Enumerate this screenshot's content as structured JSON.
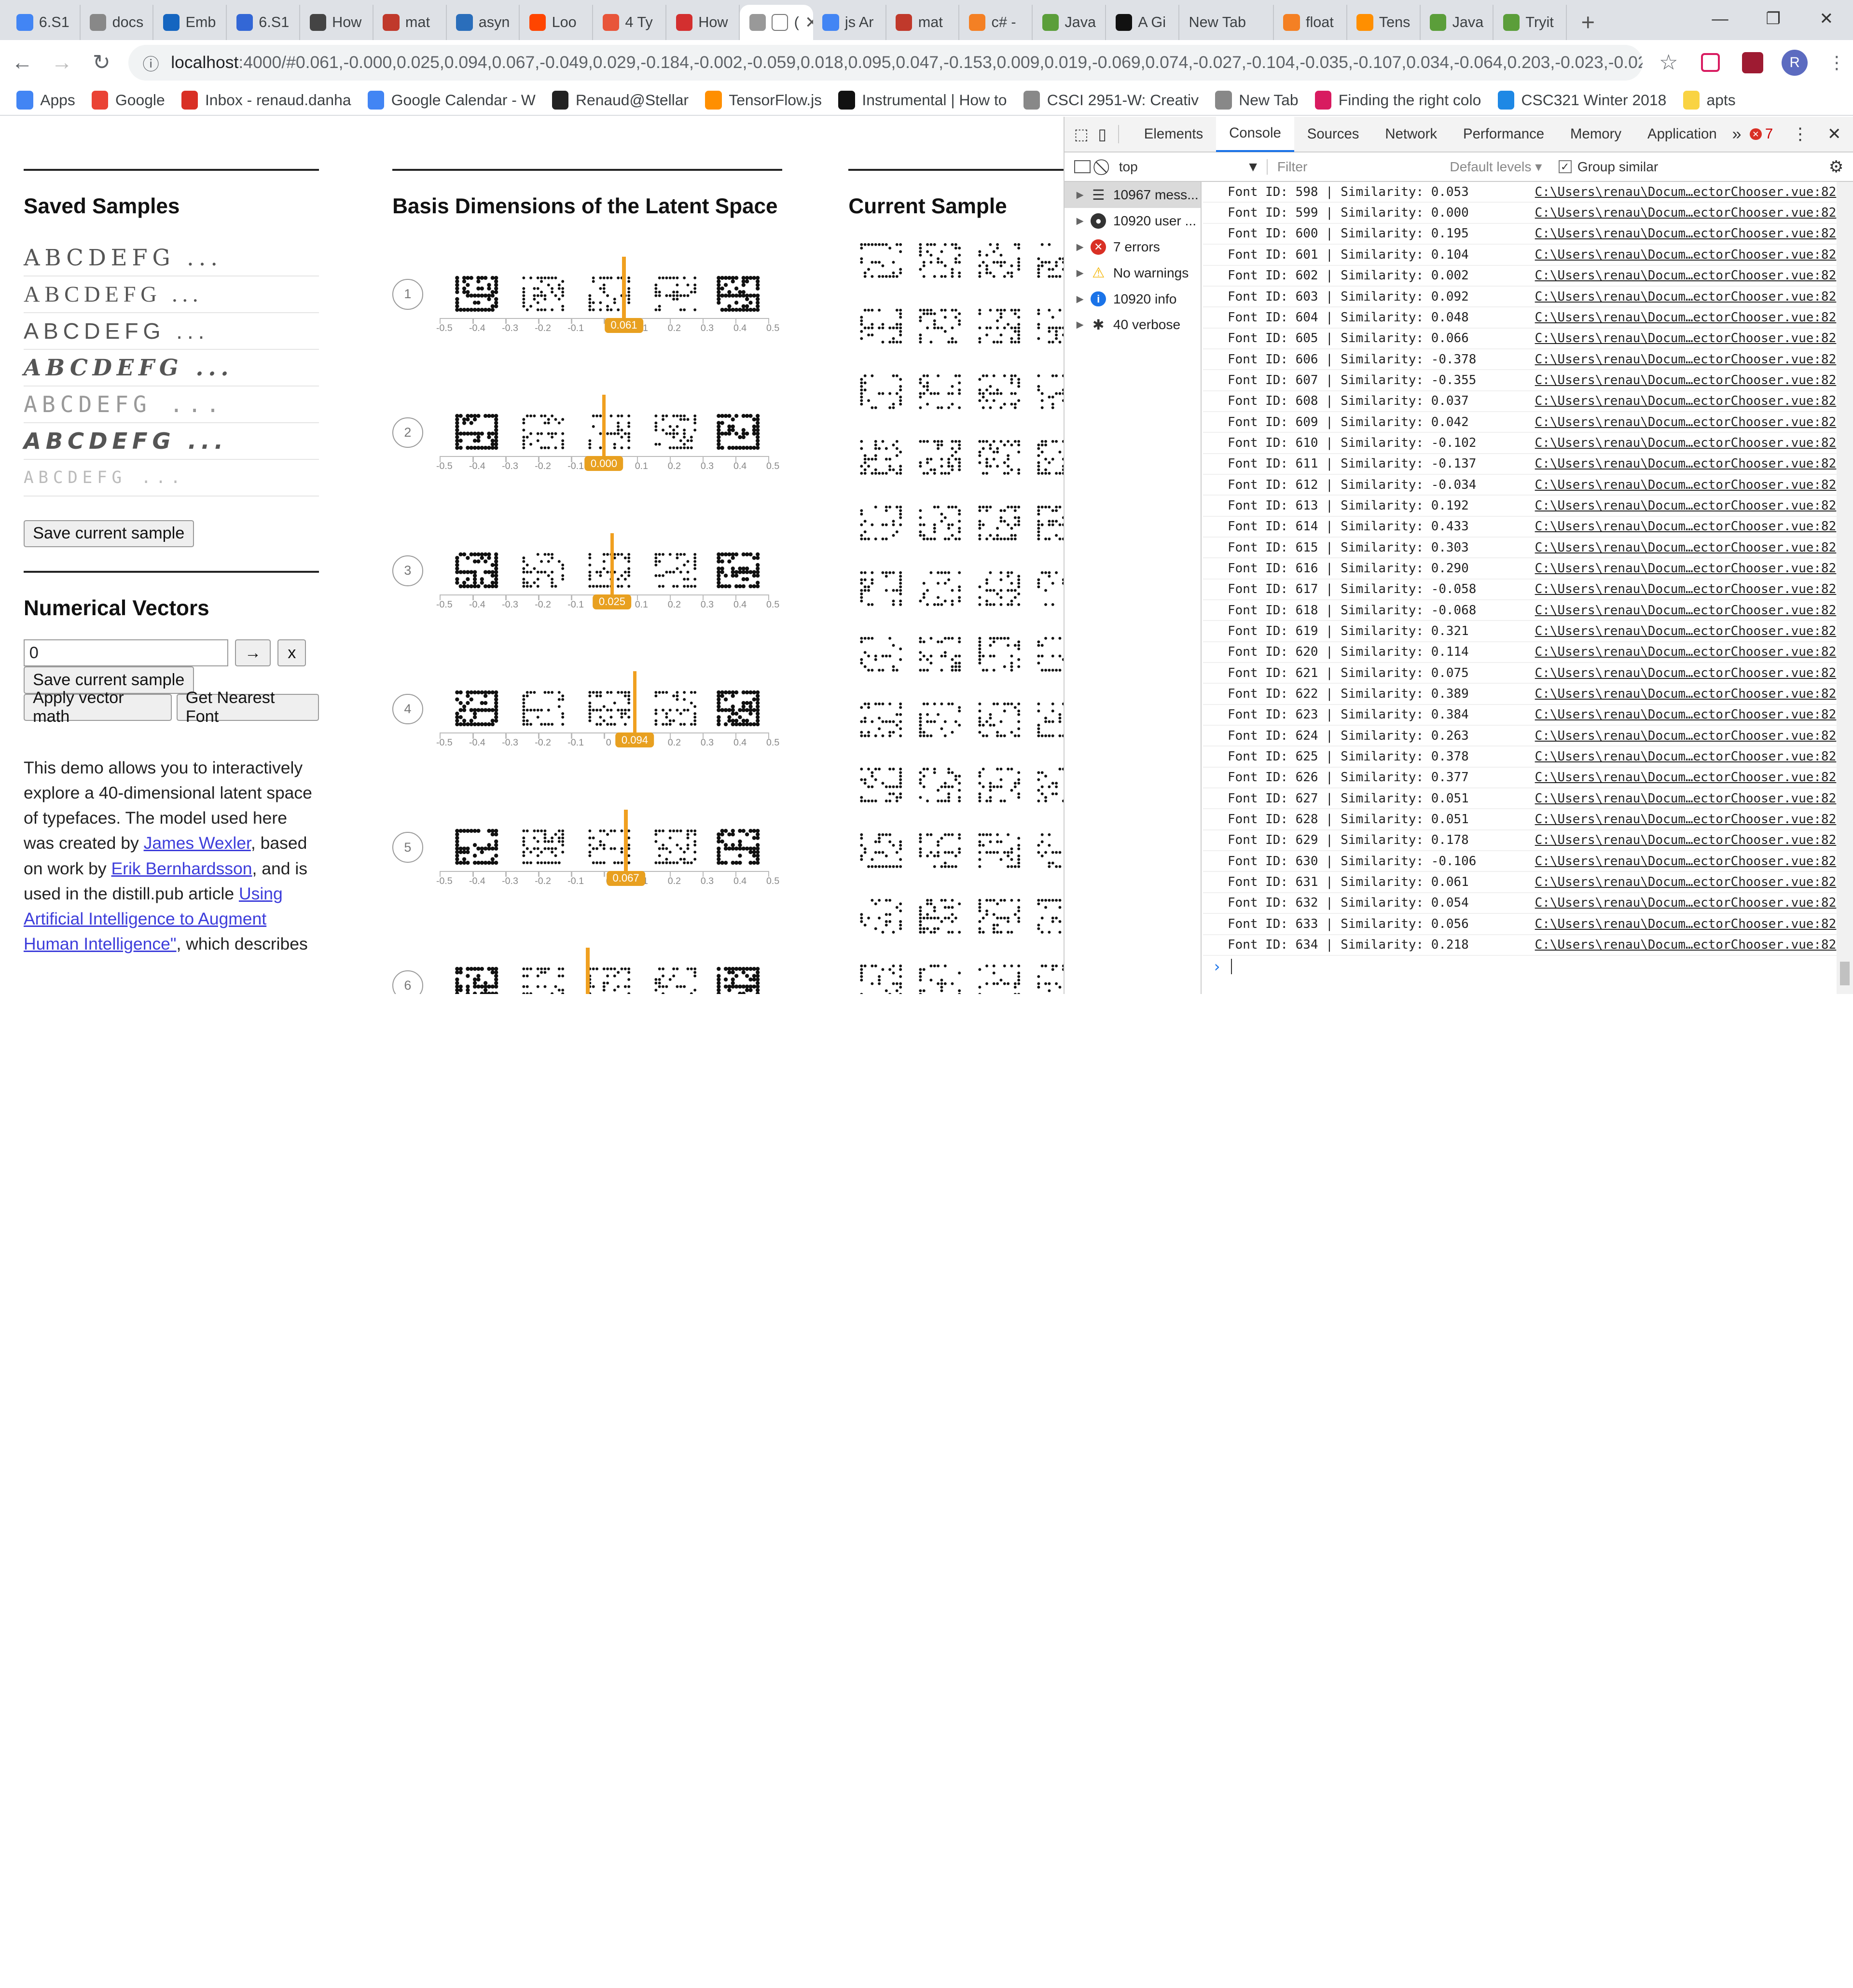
{
  "browser": {
    "tabs": [
      {
        "label": "6.S1",
        "color": "#4285f4"
      },
      {
        "label": "docs",
        "color": "#888"
      },
      {
        "label": "Emb",
        "color": "#1565c0"
      },
      {
        "label": "6.S1",
        "color": "#3367d6"
      },
      {
        "label": "How",
        "color": "#444"
      },
      {
        "label": "mat",
        "color": "#c0392b"
      },
      {
        "label": "asyn",
        "color": "#2a6ebb"
      },
      {
        "label": "Loo",
        "color": "#ff4500"
      },
      {
        "label": "4 Ty",
        "color": "#e8553a"
      },
      {
        "label": "How",
        "color": "#d32f2f"
      },
      {
        "label": "(",
        "color": "#999",
        "active": true
      },
      {
        "label": "js Ar",
        "color": "#4285f4"
      },
      {
        "label": "mat",
        "color": "#c0392b"
      },
      {
        "label": "c# -",
        "color": "#f48024"
      },
      {
        "label": "Java",
        "color": "#5b9e3a"
      },
      {
        "label": "A Gi",
        "color": "#111"
      },
      {
        "label": "New Tab",
        "color": ""
      },
      {
        "label": "float",
        "color": "#f48024"
      },
      {
        "label": "Tens",
        "color": "#ff8f00"
      },
      {
        "label": "Java",
        "color": "#5b9e3a"
      },
      {
        "label": "Tryit",
        "color": "#5b9e3a"
      }
    ],
    "url_host": "localhost",
    "url_rest": ":4000/#0.061,-0.000,0.025,0.094,0.067,-0.049,0.029,-0.184,-0.002,-0.059,0.018,0.095,0.047,-0.153,0.009,0.019,-0.069,0.074,-0.027,-0.104,-0.035,-0.107,0.034,-0.064,0.203,-0.023,-0.023,0.0...",
    "profile_initial": "R",
    "bookmarks": [
      {
        "label": "Apps",
        "icon": "apps-icon",
        "color": "#4285f4"
      },
      {
        "label": "Google",
        "icon": "google-icon",
        "color": "#ea4335"
      },
      {
        "label": "Inbox - renaud.danha",
        "icon": "gmail-icon",
        "color": "#d93025"
      },
      {
        "label": "Google Calendar - W",
        "icon": "calendar-icon",
        "color": "#4285f4"
      },
      {
        "label": "Renaud@Stellar",
        "icon": "stellar-icon",
        "color": "#222"
      },
      {
        "label": "TensorFlow.js",
        "icon": "tensorflow-icon",
        "color": "#ff8f00"
      },
      {
        "label": "Instrumental | How to",
        "icon": "instrumental-icon",
        "color": "#111"
      },
      {
        "label": "CSCI 2951-W: Creativ",
        "icon": "page-icon",
        "color": "#888"
      },
      {
        "label": "New Tab",
        "icon": "page-icon",
        "color": "#888"
      },
      {
        "label": "Finding the right colo",
        "icon": "linkedin-in-icon",
        "color": "#d81b60"
      },
      {
        "label": "CSC321 Winter 2018",
        "icon": "gear-bookmark-icon",
        "color": "#1e88e5"
      },
      {
        "label": "apts",
        "icon": "folder-icon",
        "color": "#f9d342"
      }
    ]
  },
  "left": {
    "saved_title": "Saved Samples",
    "samples": [
      "ABCDEFG ...",
      "ABCDEFG ...",
      "ABCDEFG ...",
      "ABCDEFG ...",
      "ABCDEFG ...",
      "ABCDEFG ...",
      "ABCDEFG ..."
    ],
    "save_btn": "Save current sample",
    "numvec_title": "Numerical Vectors",
    "numvec_value": "0",
    "arrow_btn": "→",
    "x_btn": "x",
    "save_btn2": "Save current sample",
    "apply_btn": "Apply vector math",
    "nearest_btn": "Get Nearest Font",
    "desc_pre": "This demo allows you to interactively explore a 40-dimensional latent space of typefaces. The model used here was created by ",
    "link1": "James Wexler",
    "desc_mid": ", based on work by ",
    "link2": "Erik Bernhardsson",
    "desc_mid2": ", and is used in the distill.pub article ",
    "link3": "Using Artificial Intelligence to Augment Human Intelligence\"",
    "desc_post": ", which describes"
  },
  "basis": {
    "title": "Basis Dimensions of the Latent Space",
    "ticks": [
      "-0.5",
      "-0.4",
      "-0.3",
      "-0.2",
      "-0.1",
      "0",
      "0.1",
      "0.2",
      "0.3",
      "0.4",
      "0.5"
    ],
    "rows": [
      {
        "n": "1",
        "value": 0.061,
        "label": "0.061"
      },
      {
        "n": "2",
        "value": 0.0,
        "label": "0.000"
      },
      {
        "n": "3",
        "value": 0.025,
        "label": "0.025"
      },
      {
        "n": "4",
        "value": 0.094,
        "label": "0.094"
      },
      {
        "n": "5",
        "value": 0.067,
        "label": "0.067"
      },
      {
        "n": "6",
        "value": -0.049,
        "label": ""
      }
    ]
  },
  "current": {
    "title": "Current Sample",
    "letters": [
      "a",
      "B",
      "C",
      "D",
      "e",
      "F",
      "G",
      "H",
      "I",
      "J",
      "K",
      "L",
      "M",
      "N",
      "O",
      "P",
      "Q",
      "R",
      "S",
      "T",
      "U",
      "V",
      "W",
      "X",
      "Y",
      "Z",
      "A",
      "B",
      "C",
      "D",
      "E",
      "F",
      "G",
      "H",
      "I",
      "J",
      "K",
      "L",
      "M",
      "N",
      "O",
      "P",
      "Q",
      "R",
      "S",
      "T",
      "U",
      "V"
    ]
  },
  "devtools": {
    "tabs": [
      "Elements",
      "Console",
      "Sources",
      "Network",
      "Performance",
      "Memory",
      "Application"
    ],
    "more": "»",
    "error_count": "7",
    "context": "top",
    "filter_placeholder": "Filter",
    "levels": "Default levels ▾",
    "group_similar": "Group similar",
    "sidebar": [
      {
        "label": "10967 mess...",
        "icon": "list-icon"
      },
      {
        "label": "10920 user ...",
        "icon": "user-icon"
      },
      {
        "label": "7 errors",
        "icon": "error-icon"
      },
      {
        "label": "No warnings",
        "icon": "warning-icon"
      },
      {
        "label": "10920 info",
        "icon": "info-icon"
      },
      {
        "label": "40 verbose",
        "icon": "bug-icon"
      }
    ],
    "log_source": "C:\\Users\\renau\\Docum…ectorChooser.vue:82",
    "logs": [
      [
        "598",
        "0.053"
      ],
      [
        "599",
        "0.000"
      ],
      [
        "600",
        "0.195"
      ],
      [
        "601",
        "0.104"
      ],
      [
        "602",
        "0.002"
      ],
      [
        "603",
        "0.092"
      ],
      [
        "604",
        "0.048"
      ],
      [
        "605",
        "0.066"
      ],
      [
        "606",
        "-0.378"
      ],
      [
        "607",
        "-0.355"
      ],
      [
        "608",
        "0.037"
      ],
      [
        "609",
        "0.042"
      ],
      [
        "610",
        "-0.102"
      ],
      [
        "611",
        "-0.137"
      ],
      [
        "612",
        "-0.034"
      ],
      [
        "613",
        "0.192"
      ],
      [
        "614",
        "0.433"
      ],
      [
        "615",
        "0.303"
      ],
      [
        "616",
        "0.290"
      ],
      [
        "617",
        "-0.058"
      ],
      [
        "618",
        "-0.068"
      ],
      [
        "619",
        "0.321"
      ],
      [
        "620",
        "0.114"
      ],
      [
        "621",
        "0.075"
      ],
      [
        "622",
        "0.389"
      ],
      [
        "623",
        "0.384"
      ],
      [
        "624",
        "0.263"
      ],
      [
        "625",
        "0.378"
      ],
      [
        "626",
        "0.377"
      ],
      [
        "627",
        "0.051"
      ],
      [
        "628",
        "0.051"
      ],
      [
        "629",
        "0.178"
      ],
      [
        "630",
        "-0.106"
      ],
      [
        "631",
        "0.061"
      ],
      [
        "632",
        "0.054"
      ],
      [
        "633",
        "0.056"
      ],
      [
        "634",
        "0.218"
      ]
    ]
  }
}
